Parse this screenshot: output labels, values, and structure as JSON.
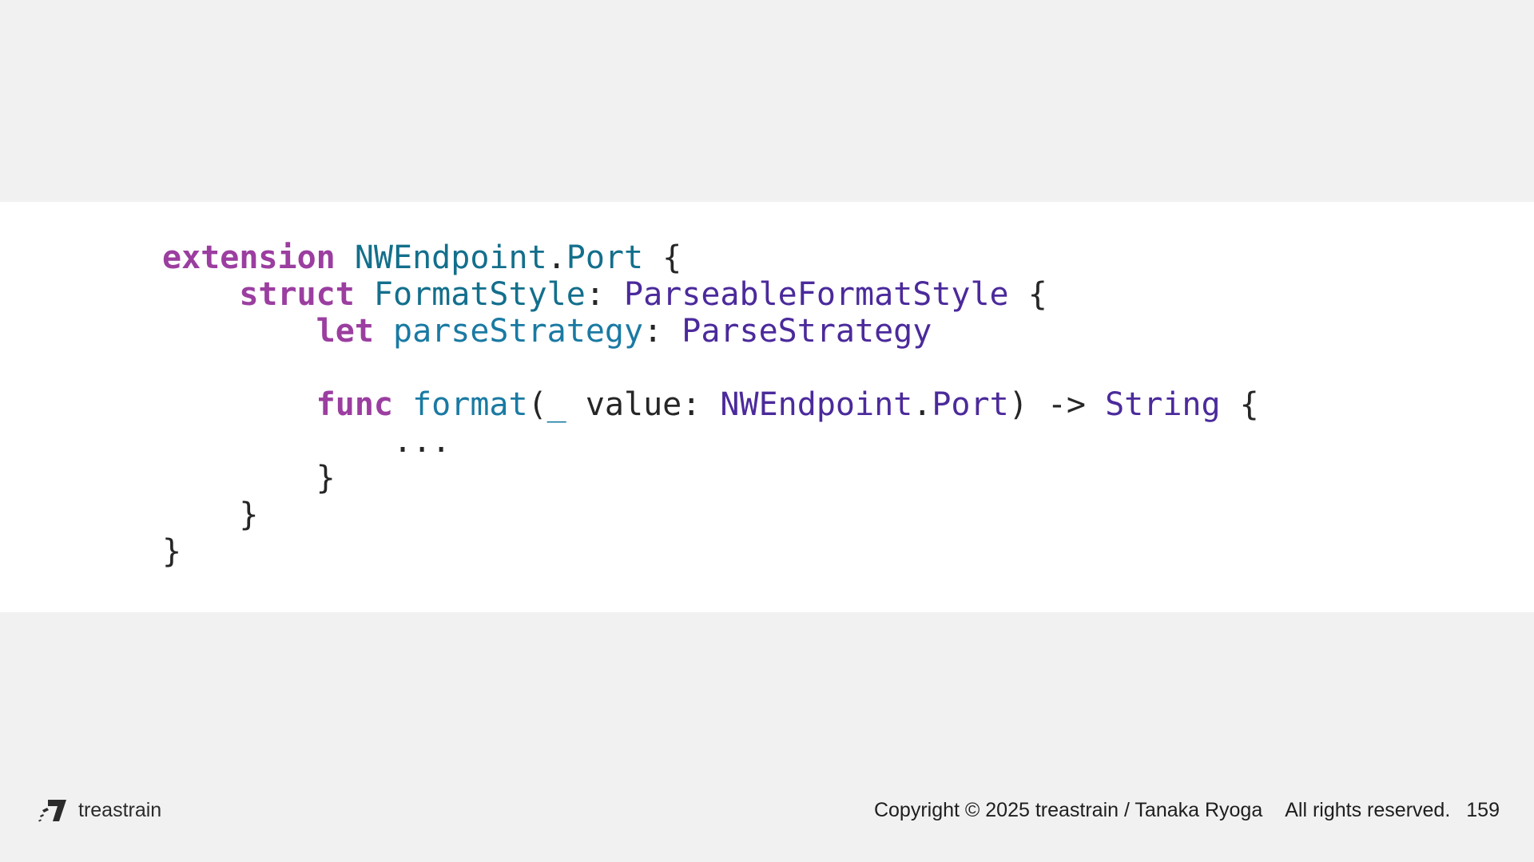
{
  "code": {
    "lines": [
      [
        {
          "text": "extension",
          "kind": "kw"
        },
        {
          "text": " ",
          "kind": "pl"
        },
        {
          "text": "NWEndpoint",
          "kind": "ty"
        },
        {
          "text": ".",
          "kind": "pl"
        },
        {
          "text": "Port",
          "kind": "ty"
        },
        {
          "text": " {",
          "kind": "pl"
        }
      ],
      [
        {
          "text": "    ",
          "kind": "pl"
        },
        {
          "text": "struct",
          "kind": "kw"
        },
        {
          "text": " ",
          "kind": "pl"
        },
        {
          "text": "FormatStyle",
          "kind": "ty"
        },
        {
          "text": ": ",
          "kind": "pl"
        },
        {
          "text": "ParseableFormatStyle",
          "kind": "pt"
        },
        {
          "text": " {",
          "kind": "pl"
        }
      ],
      [
        {
          "text": "        ",
          "kind": "pl"
        },
        {
          "text": "let",
          "kind": "kw"
        },
        {
          "text": " ",
          "kind": "pl"
        },
        {
          "text": "parseStrategy",
          "kind": "id"
        },
        {
          "text": ": ",
          "kind": "pl"
        },
        {
          "text": "ParseStrategy",
          "kind": "pt"
        }
      ],
      [],
      [
        {
          "text": "        ",
          "kind": "pl"
        },
        {
          "text": "func",
          "kind": "kw"
        },
        {
          "text": " ",
          "kind": "pl"
        },
        {
          "text": "format",
          "kind": "id"
        },
        {
          "text": "(",
          "kind": "pl"
        },
        {
          "text": "_",
          "kind": "id"
        },
        {
          "text": " value: ",
          "kind": "pl"
        },
        {
          "text": "NWEndpoint",
          "kind": "pt"
        },
        {
          "text": ".",
          "kind": "pl"
        },
        {
          "text": "Port",
          "kind": "pt"
        },
        {
          "text": ") -> ",
          "kind": "pl"
        },
        {
          "text": "String",
          "kind": "pt"
        },
        {
          "text": " {",
          "kind": "pl"
        }
      ],
      [
        {
          "text": "            ...",
          "kind": "pl"
        }
      ],
      [
        {
          "text": "        }",
          "kind": "pl"
        }
      ],
      [
        {
          "text": "    }",
          "kind": "pl"
        }
      ],
      [
        {
          "text": "}",
          "kind": "pl"
        }
      ]
    ]
  },
  "footer": {
    "logo_text": "treastrain",
    "logo_icon": "treastrain-logo-icon",
    "copyright": "Copyright © 2025 treastrain / Tanaka Ryoga",
    "rights": "All rights reserved.",
    "page_number": "159"
  },
  "colors": {
    "background": "#f1f1f1",
    "code_panel": "#ffffff",
    "keyword": "#9b3ea0",
    "type": "#136f8c",
    "protocol_type": "#4b2a9b",
    "identifier": "#1a7aa3",
    "plain": "#262626"
  }
}
